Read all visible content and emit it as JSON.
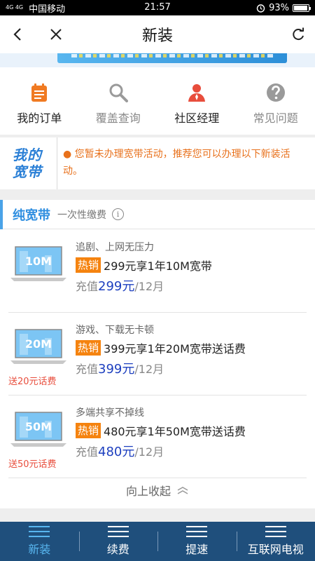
{
  "status": {
    "signal": "4G 4G",
    "carrier": "中国移动",
    "time": "21:57",
    "battery": "93%"
  },
  "header": {
    "title": "新装"
  },
  "quick_menu": [
    {
      "label": "我的订单",
      "icon": "order-icon",
      "color": "#f07a22"
    },
    {
      "label": "覆盖查询",
      "icon": "search-icon",
      "color": "#999999"
    },
    {
      "label": "社区经理",
      "icon": "manager-icon",
      "color": "#e84d3c"
    },
    {
      "label": "常见问题",
      "icon": "question-icon",
      "color": "#999999"
    }
  ],
  "notice": {
    "logo_line1": "我的",
    "logo_line2": "宽带",
    "text": "● 您暂未办理宽带活动，推荐您可以办理以下新装活动。"
  },
  "package": {
    "name": "纯宽带",
    "subtitle": "一次性缴费",
    "info_label": "i",
    "collapse_label": "向上收起",
    "items": [
      {
        "speed": "10M",
        "tagline": "追剧、上网无压力",
        "badge": "热销",
        "title": "299元享1年10M宽带",
        "price_prefix": "充值",
        "price": "299元",
        "period": "/12月",
        "gift": ""
      },
      {
        "speed": "20M",
        "tagline": "游戏、下载无卡顿",
        "badge": "热销",
        "title": "399元享1年20M宽带送话费",
        "price_prefix": "充值",
        "price": "399元",
        "period": "/12月",
        "gift": "送20元话费"
      },
      {
        "speed": "50M",
        "tagline": "多端共享不掉线",
        "badge": "热销",
        "title": "480元享1年50M宽带送话费",
        "price_prefix": "充值",
        "price": "480元",
        "period": "/12月",
        "gift": "送50元话费"
      }
    ]
  },
  "nav": [
    {
      "label": "新装",
      "active": true
    },
    {
      "label": "续费",
      "active": false
    },
    {
      "label": "提速",
      "active": false
    },
    {
      "label": "互联网电视",
      "active": false
    }
  ],
  "colors": {
    "accent": "#2e8ee0",
    "hot": "#f5830f",
    "nav_bg": "#1f4f7c",
    "price": "#1d3fbf"
  }
}
